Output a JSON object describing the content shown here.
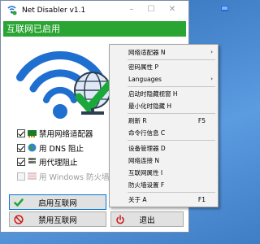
{
  "window": {
    "title": "Net Disabler v1.1"
  },
  "status": {
    "text": "互联网已启用",
    "color": "#2aa533"
  },
  "options": {
    "disable_adapter": {
      "label": "禁用网络适配器",
      "checked": true,
      "icon": "network-adapter-icon"
    },
    "dns_block": {
      "label": "用 DNS 阻止",
      "checked": true,
      "icon": "globe-icon"
    },
    "proxy_block": {
      "label": "用代理阻止",
      "checked": true,
      "icon": "proxy-icon"
    },
    "firewall_block": {
      "label": "用 Windows 防火墙阻",
      "checked": false,
      "disabled": true,
      "icon": "firewall-icon"
    }
  },
  "buttons": {
    "enable_internet": "启用互联网",
    "disable_internet": "禁用互联网",
    "exit": "退出"
  },
  "menu": {
    "adapter": "网络适配器 N",
    "password": "密码属性 P",
    "languages": "Languages",
    "startup_hide": "启动时隐藏视窗 H",
    "minimize_hide": "最小化时隐藏 H",
    "refresh": "刷新 R",
    "refresh_shortcut": "F5",
    "cmd": "命令行信息 C",
    "device_manager": "设备管理器 D",
    "network_conn": "网络连接 N",
    "internet_props": "互联网属性 I",
    "firewall_settings": "防火墙设置 F",
    "about": "关于 A",
    "about_shortcut": "F1"
  },
  "colors": {
    "accent": "#0078d7",
    "wifi_blue": "#1e6fd0",
    "check_green": "#1aa83a"
  }
}
